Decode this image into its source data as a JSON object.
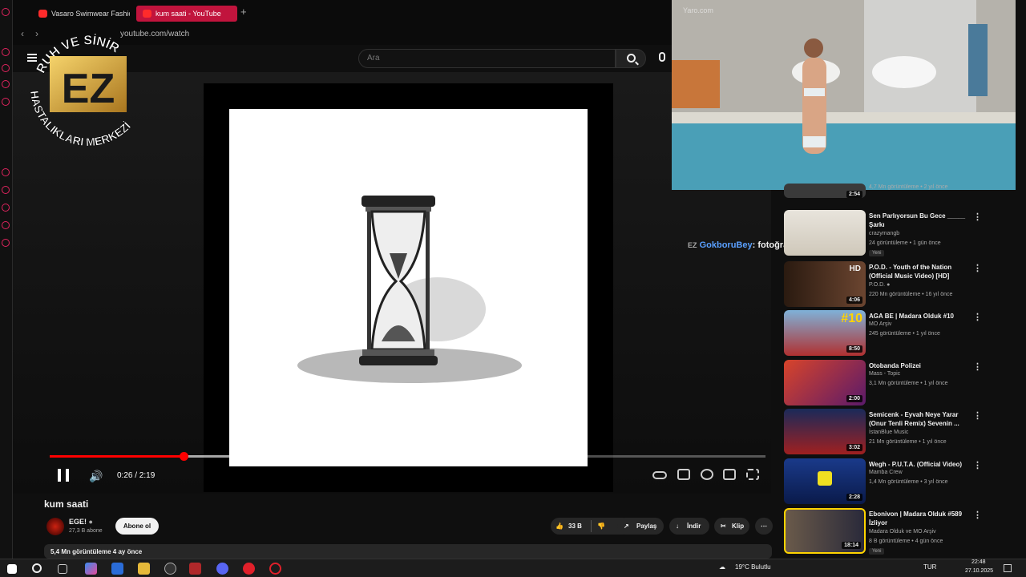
{
  "browser": {
    "tabs": [
      {
        "label": "Vasaro Swimwear Fashion",
        "active": false
      },
      {
        "label": "kum saati - YouTube",
        "active": true
      }
    ],
    "new_tab": "+",
    "url": "youtube.com/watch"
  },
  "logo": {
    "top_text": "RUH VE SİNİR",
    "mark": "EZ",
    "bottom_text": "HASTALIKLARI MERKEZİ"
  },
  "header": {
    "search_placeholder": "Ara"
  },
  "player": {
    "time": "0:26 / 2:19",
    "progress": 0.187,
    "buffered": 0.6
  },
  "video": {
    "title": "kum saati",
    "channel": "EGE!",
    "subscribers": "27,3 B abone",
    "subscribe_label": "Abone ol",
    "likes": "33 B",
    "share_label": "Paylaş",
    "download_label": "İndir",
    "clip_label": "Klip",
    "description_meta": "5,4 Mn görüntüleme  4 ay önce"
  },
  "chat": {
    "user": "GokboruBey",
    "message": ": fotoğrafçı dedi gülümse"
  },
  "sidebar": {
    "items": [
      {
        "title": "",
        "channel": "",
        "meta": "4,7 Mn görüntüleme • 2 yıl önce",
        "duration": "2:54",
        "badge": ""
      },
      {
        "title": "Sen Parlıyorsun Bu Gece _____ Şarkı",
        "channel": "crazymangb",
        "meta": "24 görüntüleme • 1 gün önce",
        "duration": "",
        "badge": "Yeni"
      },
      {
        "title": "P.O.D. - Youth of the Nation (Official Music Video) [HD]",
        "channel": "P.O.D.",
        "meta": "220 Mn görüntüleme • 16 yıl önce",
        "duration": "4:06",
        "badge": ""
      },
      {
        "title": "AGA BE | Madara Olduk #10",
        "channel": "MO Arşiv",
        "meta": "245 görüntüleme • 1 yıl önce",
        "duration": "8:50",
        "badge": ""
      },
      {
        "title": "Otobanda Polizei",
        "channel": "Mass - Topic",
        "meta": "3,1 Mn görüntüleme • 1 yıl önce",
        "duration": "2:00",
        "badge": ""
      },
      {
        "title": "Semicenk - Eyvah Neye Yarar (Onur Tenli Remix) Sevenin ...",
        "channel": "İstanBlue Music",
        "meta": "21 Mn görüntüleme • 1 yıl önce",
        "duration": "3:02",
        "badge": ""
      },
      {
        "title": "Wegh - P.U.T.A. (Official Video)",
        "channel": "Mamba Crew",
        "meta": "1,4 Mn görüntüleme • 3 yıl önce",
        "duration": "2:28",
        "badge": ""
      },
      {
        "title": "Ebonivon | Madara Olduk #589 İzliyor",
        "channel": "Madara Olduk ve MO Arşiv",
        "meta": "8 B görüntüleme • 4 gün önce",
        "duration": "18:14",
        "badge": "Yeni"
      }
    ]
  },
  "taskbar": {
    "weather": "19°C  Bulutlu",
    "lang": "TUR",
    "time": "22:48",
    "date": "27.10.2025"
  },
  "colors": {
    "accent": "#ff0000",
    "tab_active": "#c1143d",
    "chat_user": "#5aa0ff"
  }
}
